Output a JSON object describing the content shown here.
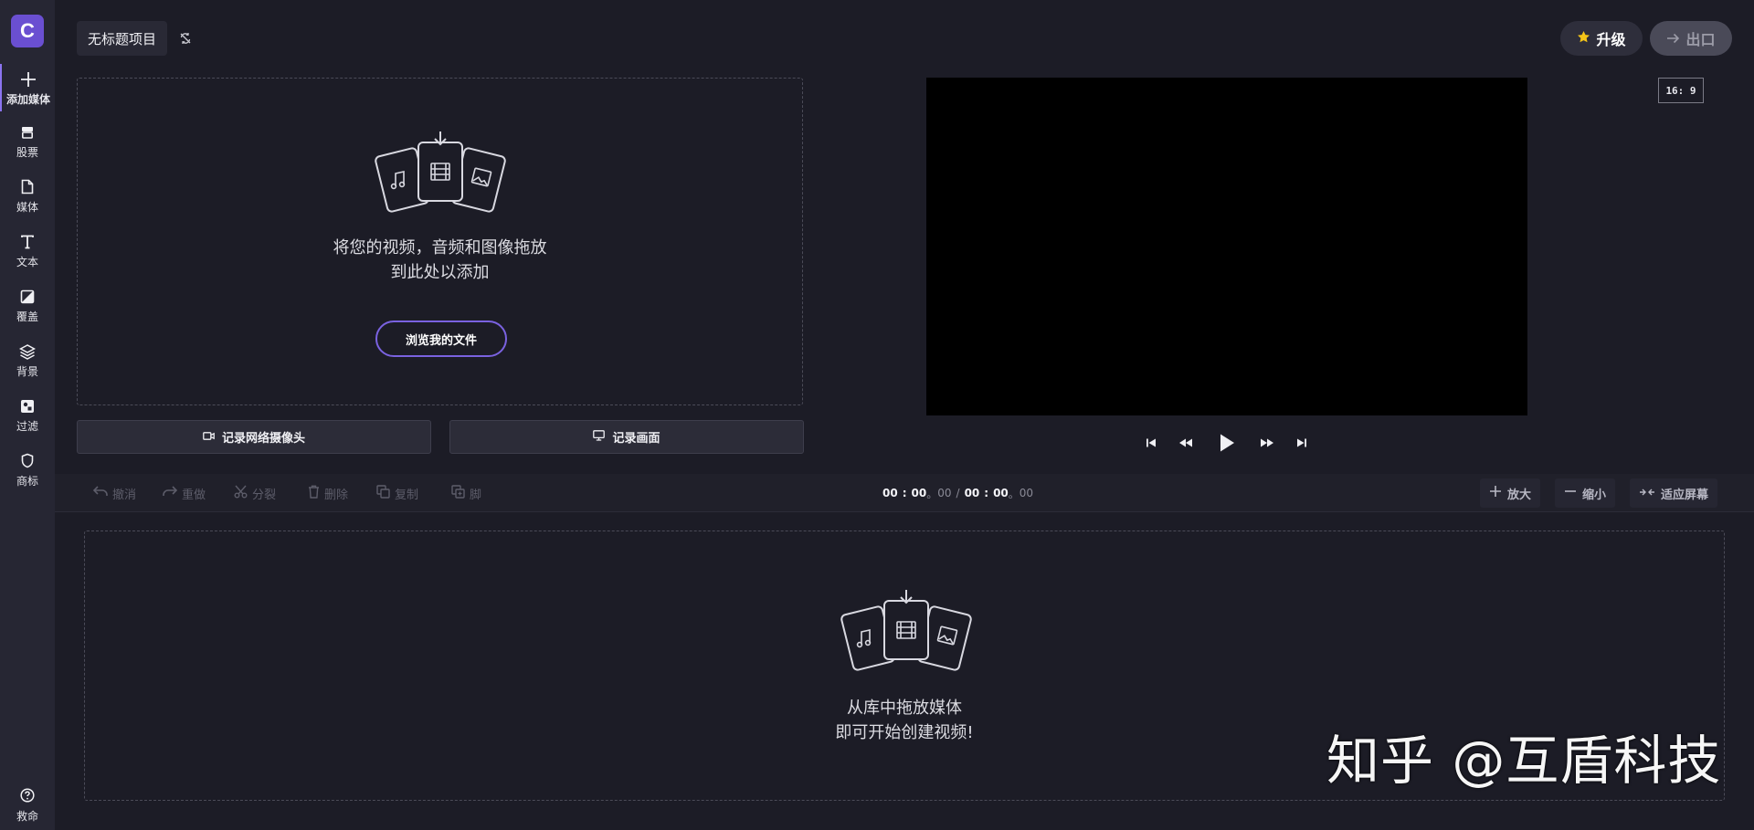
{
  "app": {
    "logo_letter": "C",
    "project_title": "无标题项目"
  },
  "sidebar": {
    "items": [
      {
        "label": "添加媒体",
        "icon": "plus-icon"
      },
      {
        "label": "股票",
        "icon": "store-icon"
      },
      {
        "label": "媒体",
        "icon": "file-icon"
      },
      {
        "label": "文本",
        "icon": "text-icon"
      },
      {
        "label": "覆盖",
        "icon": "overlay-icon"
      },
      {
        "label": "背景",
        "icon": "layers-icon"
      },
      {
        "label": "过滤",
        "icon": "filter-icon"
      },
      {
        "label": "商标",
        "icon": "shield-icon"
      }
    ],
    "help_label": "救命"
  },
  "header": {
    "upgrade_label": "升级",
    "export_label": "出口",
    "aspect_ratio": "16: 9"
  },
  "media_drop": {
    "line1": "将您的视频，音频和图像拖放",
    "line2": "到此处以添加",
    "browse_label": "浏览我的文件"
  },
  "record": {
    "webcam_label": "记录网络摄像头",
    "screen_label": "记录画面"
  },
  "toolbar": {
    "undo": "撤消",
    "redo": "重做",
    "split": "分裂",
    "delete": "删除",
    "copy": "复制",
    "dup": "脚",
    "time_current": {
      "mm": "00",
      "ss": "00",
      "ff": "00"
    },
    "time_total": {
      "mm": "00",
      "ss": "00",
      "ff": "00"
    },
    "zoom_in": "放大",
    "zoom_out": "缩小",
    "fit": "适应屏幕"
  },
  "timeline_drop": {
    "line1": "从库中拖放媒体",
    "line2": "即可开始创建视频!"
  },
  "watermark": "知乎 @互盾科技",
  "colors": {
    "accent": "#6a4fd1",
    "background": "#1c1c26",
    "sidebar": "#262633"
  }
}
